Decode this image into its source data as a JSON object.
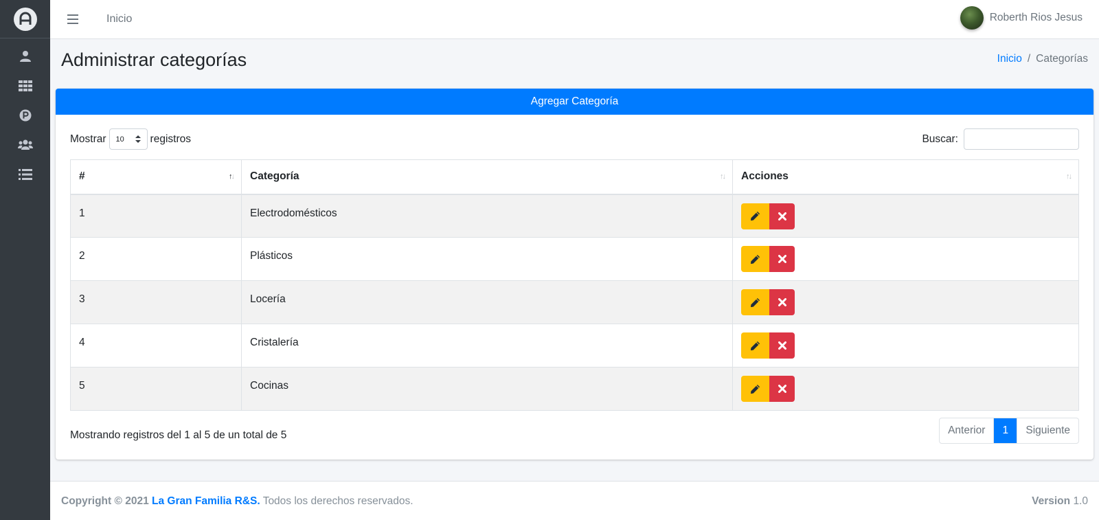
{
  "navbar": {
    "home_link": "Inicio",
    "user_name": "Roberth Rios Jesus"
  },
  "header": {
    "title": "Administrar categorías",
    "breadcrumb": {
      "home": "Inicio",
      "separator": "/",
      "current": "Categorías"
    }
  },
  "card": {
    "add_button": "Agregar Categoría",
    "length": {
      "prefix": "Mostrar",
      "value": "10",
      "suffix": "registros"
    },
    "search": {
      "label": "Buscar:",
      "value": ""
    },
    "table": {
      "headers": [
        "#",
        "Categoría",
        "Acciones"
      ],
      "rows": [
        {
          "id": "1",
          "category": "Electrodomésticos"
        },
        {
          "id": "2",
          "category": "Plásticos"
        },
        {
          "id": "3",
          "category": "Locería"
        },
        {
          "id": "4",
          "category": "Cristalería"
        },
        {
          "id": "5",
          "category": "Cocinas"
        }
      ]
    },
    "info": "Mostrando registros del 1 al 5 de un total de 5",
    "pagination": {
      "prev": "Anterior",
      "current": "1",
      "next": "Siguiente"
    }
  },
  "footer": {
    "copyright": "Copyright © 2021",
    "brand": "La Gran Familia R&S.",
    "rights": "Todos los derechos reservados.",
    "version_label": "Version",
    "version_value": "1.0"
  },
  "colors": {
    "primary": "#007bff",
    "warning": "#ffc107",
    "danger": "#dc3545",
    "sidebar": "#343a40"
  },
  "icons": {
    "sidebar": [
      "user-icon",
      "grid-icon",
      "parking-icon",
      "users-icon",
      "list-icon"
    ],
    "row_actions": [
      "pencil-icon",
      "times-icon"
    ]
  }
}
